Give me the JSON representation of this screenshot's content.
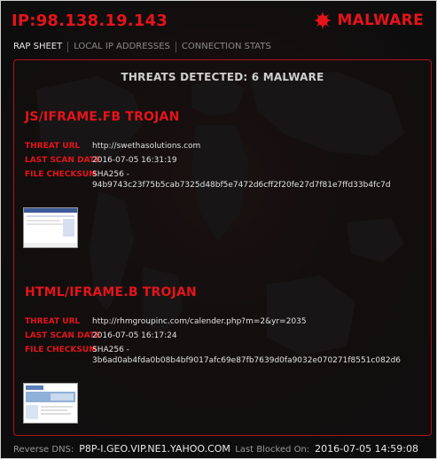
{
  "header": {
    "ip_title": "IP:98.138.19.143",
    "badge_label": "MALWARE",
    "badge_icon": "virus-icon"
  },
  "tabs": [
    {
      "label": "RAP SHEET",
      "active": true
    },
    {
      "label": "LOCAL IP ADDRESSES",
      "active": false
    },
    {
      "label": "CONNECTION STATS",
      "active": false
    }
  ],
  "panel": {
    "heading": "THREATS DETECTED: 6 MALWARE"
  },
  "threats": [
    {
      "name": "JS/IFRAME.FB TROJAN",
      "url_label": "THREAT URL",
      "url": "http://swethasolutions.com",
      "scan_label": "LAST SCAN DATE",
      "scan_date": "2016-07-05 16:31:19",
      "checksum_label": "FILE CHECKSUM",
      "checksum_type": "SHA256 -",
      "checksum": "94b9743c23f75b5cab7325d48bf5e7472d6cff2f20fe27d7f81e7ffd33b4fc7d"
    },
    {
      "name": "HTML/IFRAME.B TROJAN",
      "url_label": "THREAT URL",
      "url": "http://rhmgroupinc.com/calender.php?m=2&yr=2035",
      "scan_label": "LAST SCAN DATE",
      "scan_date": "2016-07-05 16:17:24",
      "checksum_label": "FILE CHECKSUM",
      "checksum_type": "SHA256 -",
      "checksum": "3b6ad0ab4fda0b08b4bf9017afc69e87fb7639d0fa9032e070271f8551c082d6"
    }
  ],
  "footer": {
    "dns_label": "Reverse DNS:",
    "dns_value": "P8P-I.GEO.VIP.NE1.YAHOO.COM",
    "blocked_label": "Last Blocked On:",
    "blocked_value": "2016-07-05 14:59:08"
  },
  "colors": {
    "accent": "#e5141a",
    "background": "#0d0d0d",
    "panel_border": "#b3121a"
  }
}
